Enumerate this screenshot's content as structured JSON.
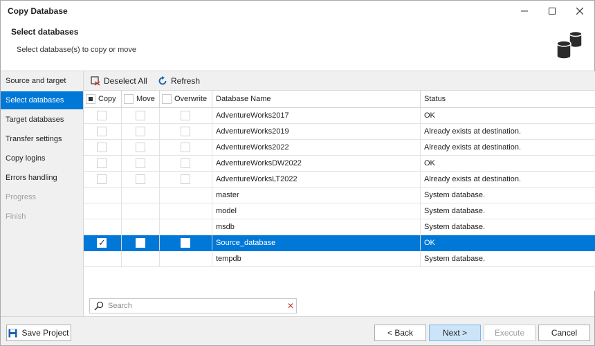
{
  "window": {
    "title": "Copy Database"
  },
  "header": {
    "title": "Select databases",
    "subtitle": "Select database(s) to copy or move",
    "icon": "database-stack-icon"
  },
  "sidebar": {
    "items": [
      {
        "label": "Source and target",
        "state": "normal"
      },
      {
        "label": "Select databases",
        "state": "active"
      },
      {
        "label": "Target databases",
        "state": "normal"
      },
      {
        "label": "Transfer settings",
        "state": "normal"
      },
      {
        "label": "Copy logins",
        "state": "normal"
      },
      {
        "label": "Errors handling",
        "state": "normal"
      },
      {
        "label": "Progress",
        "state": "disabled"
      },
      {
        "label": "Finish",
        "state": "disabled"
      }
    ]
  },
  "toolbar": {
    "deselect_label": "Deselect All",
    "refresh_label": "Refresh"
  },
  "grid": {
    "columns": {
      "copy": "Copy",
      "move": "Move",
      "overwrite": "Overwrite",
      "name": "Database Name",
      "status": "Status"
    },
    "rows": [
      {
        "name": "AdventureWorks2017",
        "status": "OK",
        "has_checks": true,
        "copy": false,
        "move": false,
        "overwrite": false,
        "selected": false
      },
      {
        "name": "AdventureWorks2019",
        "status": "Already exists at destination.",
        "has_checks": true,
        "copy": false,
        "move": false,
        "overwrite": false,
        "selected": false
      },
      {
        "name": "AdventureWorks2022",
        "status": "Already exists at destination.",
        "has_checks": true,
        "copy": false,
        "move": false,
        "overwrite": false,
        "selected": false
      },
      {
        "name": "AdventureWorksDW2022",
        "status": "OK",
        "has_checks": true,
        "copy": false,
        "move": false,
        "overwrite": false,
        "selected": false
      },
      {
        "name": "AdventureWorksLT2022",
        "status": "Already exists at destination.",
        "has_checks": true,
        "copy": false,
        "move": false,
        "overwrite": false,
        "selected": false
      },
      {
        "name": "master",
        "status": "System database.",
        "has_checks": false,
        "selected": false
      },
      {
        "name": "model",
        "status": "System database.",
        "has_checks": false,
        "selected": false
      },
      {
        "name": "msdb",
        "status": "System database.",
        "has_checks": false,
        "selected": false
      },
      {
        "name": "Source_database",
        "status": "OK",
        "has_checks": true,
        "copy": true,
        "move": false,
        "overwrite": false,
        "selected": true
      },
      {
        "name": "tempdb",
        "status": "System database.",
        "has_checks": false,
        "selected": false
      }
    ]
  },
  "search": {
    "placeholder": "Search",
    "value": ""
  },
  "footer": {
    "save_label": "Save Project",
    "back_label": "< Back",
    "next_label": "Next >",
    "execute_label": "Execute",
    "cancel_label": "Cancel"
  },
  "colors": {
    "accent": "#0078d7",
    "sidebar_bg": "#f0f0f0",
    "next_bg": "#cce4f7"
  }
}
